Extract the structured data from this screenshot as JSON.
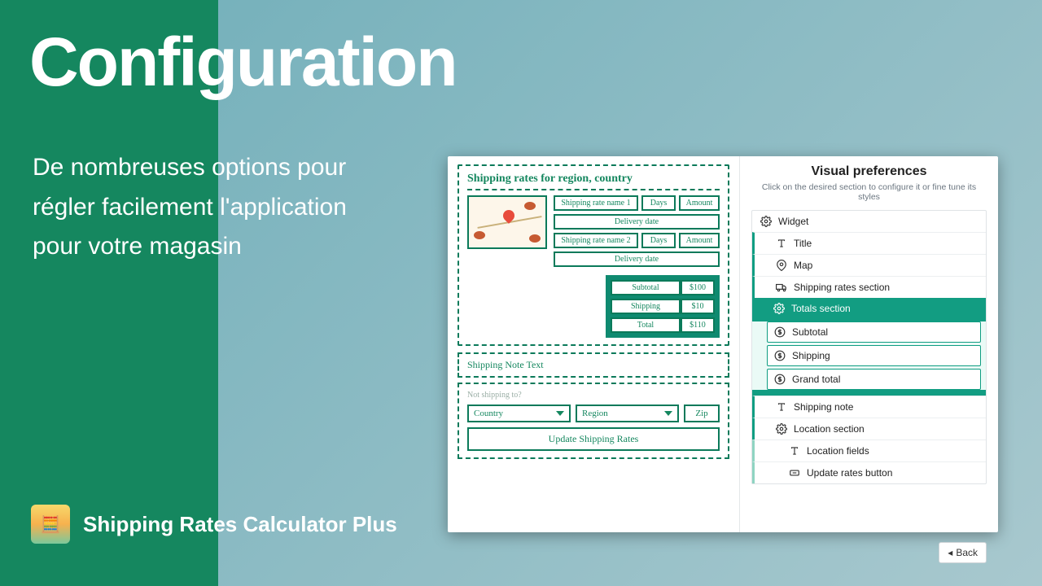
{
  "hero": {
    "title": "Configuration",
    "subtitle": "De nombreuses options pour régler facilement l'application pour votre magasin",
    "product_name": "Shipping Rates Calculator Plus"
  },
  "sketch": {
    "rates_title": "Shipping rates for region, country",
    "rate1": {
      "name": "Shipping rate name 1",
      "days": "Days",
      "amount": "Amount",
      "delivery": "Delivery date"
    },
    "rate2": {
      "name": "Shipping rate name 2",
      "days": "Days",
      "amount": "Amount",
      "delivery": "Delivery date"
    },
    "totals": {
      "subtotal_label": "Subtotal",
      "subtotal_val": "$100",
      "shipping_label": "Shipping",
      "shipping_val": "$10",
      "total_label": "Total",
      "total_val": "$110"
    },
    "note_title": "Shipping Note Text",
    "loc_label": "Not shipping to?",
    "country": "Country",
    "region": "Region",
    "zip": "Zip",
    "update_btn": "Update Shipping Rates"
  },
  "prefs": {
    "title": "Visual preferences",
    "subtitle": "Click on the desired section to configure it or fine tune its styles",
    "items": {
      "widget": "Widget",
      "title": "Title",
      "map": "Map",
      "rates_section": "Shipping rates section",
      "totals_section": "Totals section",
      "subtotal": "Subtotal",
      "shipping": "Shipping",
      "grand_total": "Grand total",
      "shipping_note": "Shipping note",
      "location_section": "Location section",
      "location_fields": "Location fields",
      "update_rates_btn": "Update rates button"
    },
    "back": "Back"
  },
  "colors": {
    "brand_green": "#15875f",
    "teal": "#129d82"
  }
}
